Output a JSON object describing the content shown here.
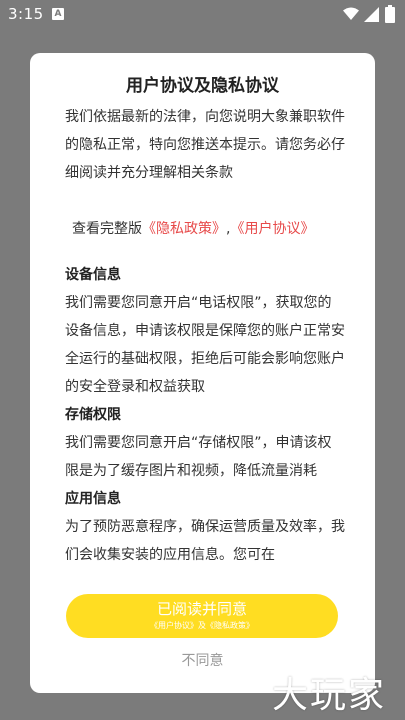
{
  "status_bar": {
    "time": "3:15",
    "notification_badge": "A",
    "icons": [
      "wifi-icon",
      "signal-icon",
      "battery-icon"
    ]
  },
  "dialog": {
    "title": "用户协议及隐私协议",
    "intro": "我们依据最新的法律，向您说明大象兼职软件的隐私正常，特向您推送本提示。请您务必仔细阅读并充分理解相关条款",
    "links_prefix": "查看完整版",
    "privacy_link": "《隐私政策》",
    "links_separator": ",",
    "user_agreement_link": "《用户协议》",
    "sections": [
      {
        "heading": "设备信息",
        "body": "我们需要您同意开启“电话权限”，获取您的设备信息，申请该权限是保障您的账户正常安全运行的基础权限，拒绝后可能会影响您账户的安全登录和权益获取"
      },
      {
        "heading": "存储权限",
        "body": "我们需要您同意开启“存储权限”，申请该权限是为了缓存图片和视频，降低流量消耗"
      },
      {
        "heading": "应用信息",
        "body": "为了预防恶意程序，确保运营质量及效率，我们会收集安装的应用信息。您可在"
      }
    ],
    "agree_label": "已阅读并同意",
    "agree_sublabel": "《用户协议》及《隐私政策》",
    "disagree_label": "不同意"
  },
  "watermark": "大玩家",
  "colors": {
    "overlay": "#7b7b7b",
    "accent_yellow": "#ffdd22",
    "link_red": "#e74a4a"
  }
}
